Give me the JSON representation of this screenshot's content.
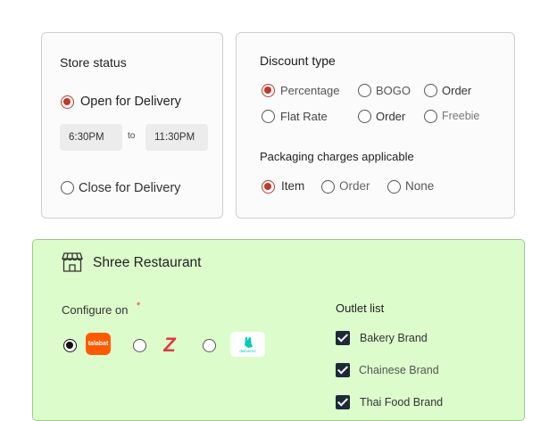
{
  "store_status": {
    "title": "Store status",
    "open_label": "Open for Delivery",
    "open_selected": true,
    "time_from": "6:30PM",
    "time_sep": "to",
    "time_to": "11:30PM",
    "close_label": "Close for Delivery",
    "close_selected": false
  },
  "discount": {
    "title": "Discount type",
    "options": [
      {
        "label": "Percentage",
        "selected": true
      },
      {
        "label": "BOGO",
        "selected": false
      },
      {
        "label": "Order",
        "selected": false
      },
      {
        "label": "Flat Rate",
        "selected": false
      },
      {
        "label": "Order",
        "selected": false
      },
      {
        "label": "Freebie",
        "selected": false
      }
    ],
    "packaging_title": "Packaging charges applicable",
    "packaging_options": [
      {
        "label": "Item",
        "selected": true
      },
      {
        "label": "Order",
        "selected": false
      },
      {
        "label": "None",
        "selected": false
      }
    ]
  },
  "restaurant": {
    "name": "Shree Restaurant",
    "configure_label": "Configure on",
    "required_mark": "*",
    "platforms": [
      {
        "name": "talabat",
        "logo_text": "talabat",
        "color": "#ff5a00",
        "selected": true
      },
      {
        "name": "zomato",
        "logo_text": "Z",
        "color": "#e23744",
        "selected": false
      },
      {
        "name": "deliveroo",
        "logo_text": "deliveroo",
        "color": "#00ccbc",
        "selected": false
      }
    ],
    "outlet_title": "Outlet list",
    "outlets": [
      {
        "label": "Bakery Brand",
        "checked": true
      },
      {
        "label": "Chainese Brand",
        "checked": true
      },
      {
        "label": "Thai Food Brand",
        "checked": true
      }
    ]
  },
  "colors": {
    "accent_red": "#c0392b",
    "panel_green": "#dcfccb",
    "checkbox_dark": "#1e2a3a"
  }
}
